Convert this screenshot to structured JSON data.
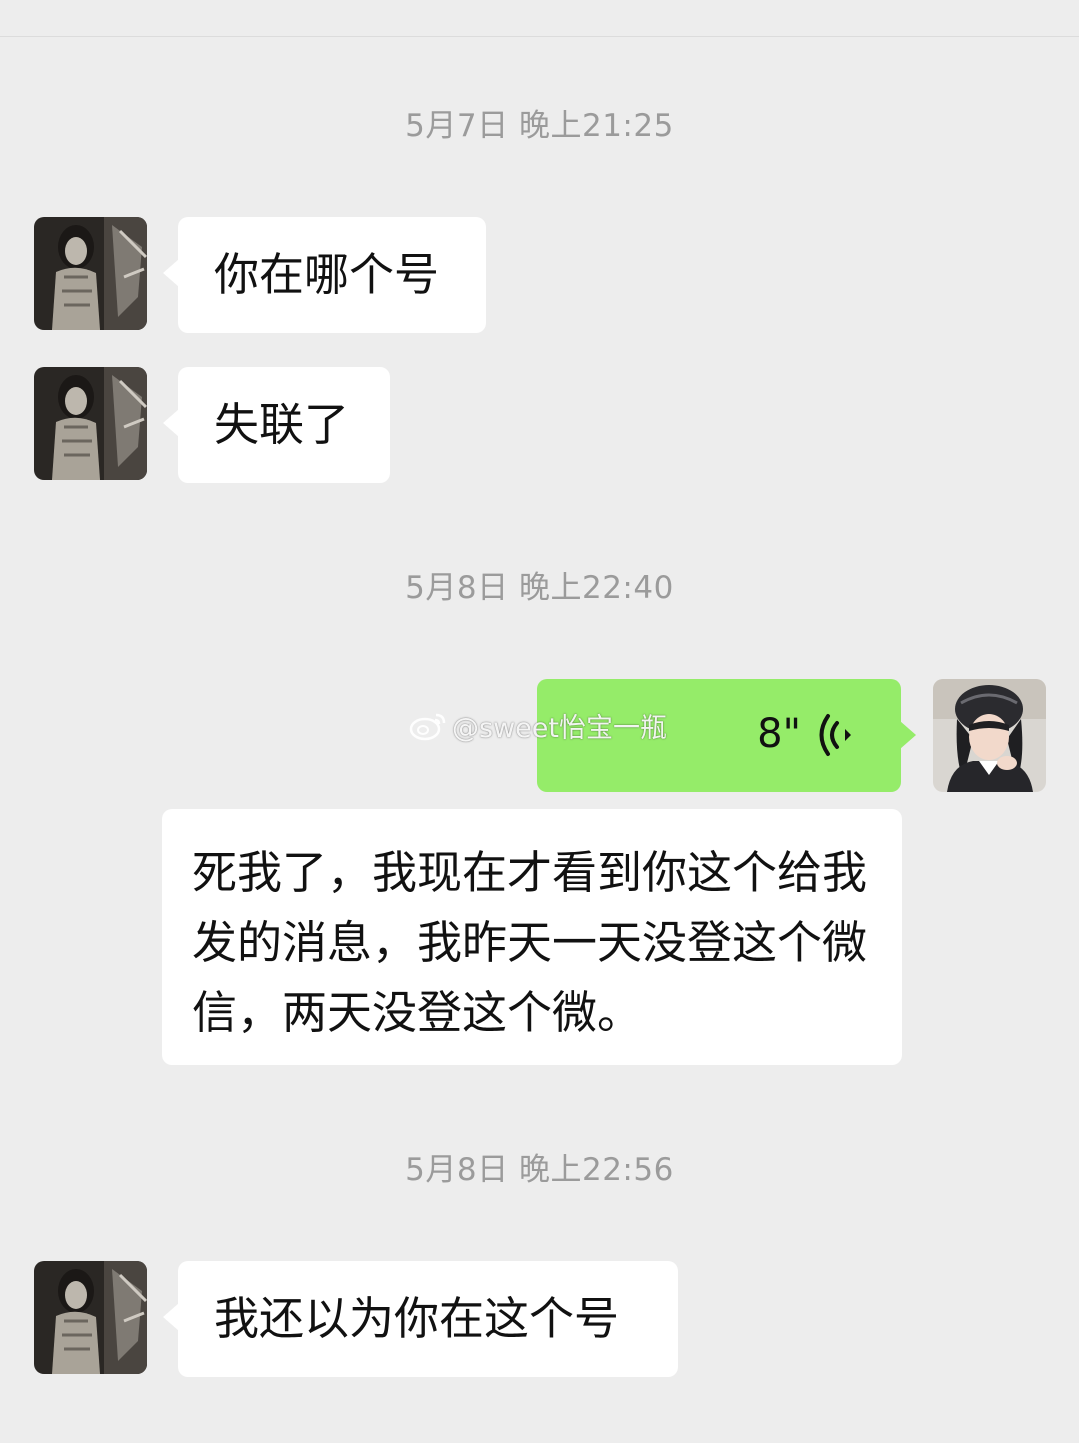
{
  "chat": {
    "timestamps": [
      "5月7日 晚上21:25",
      "5月8日 晚上22:40",
      "5月8日 晚上22:56"
    ],
    "messages": [
      {
        "sender": "contact",
        "text": "你在哪个号"
      },
      {
        "sender": "contact",
        "text": "失联了"
      },
      {
        "sender": "me",
        "type": "voice",
        "duration": "8\""
      },
      {
        "sender": "contact",
        "text": "死我了，我现在才看到你这个给我发的消息，我昨天一天没登这个微信，两天没登这个微。"
      },
      {
        "sender": "contact",
        "text": "我还以为你在这个号"
      }
    ]
  },
  "watermark": {
    "text": "@sweet怡宝一瓶",
    "icon": "weibo-icon"
  },
  "colors": {
    "background": "#ededed",
    "incoming_bubble": "#ffffff",
    "outgoing_bubble": "#95ec69",
    "timestamp_text": "#9b9b9b"
  }
}
